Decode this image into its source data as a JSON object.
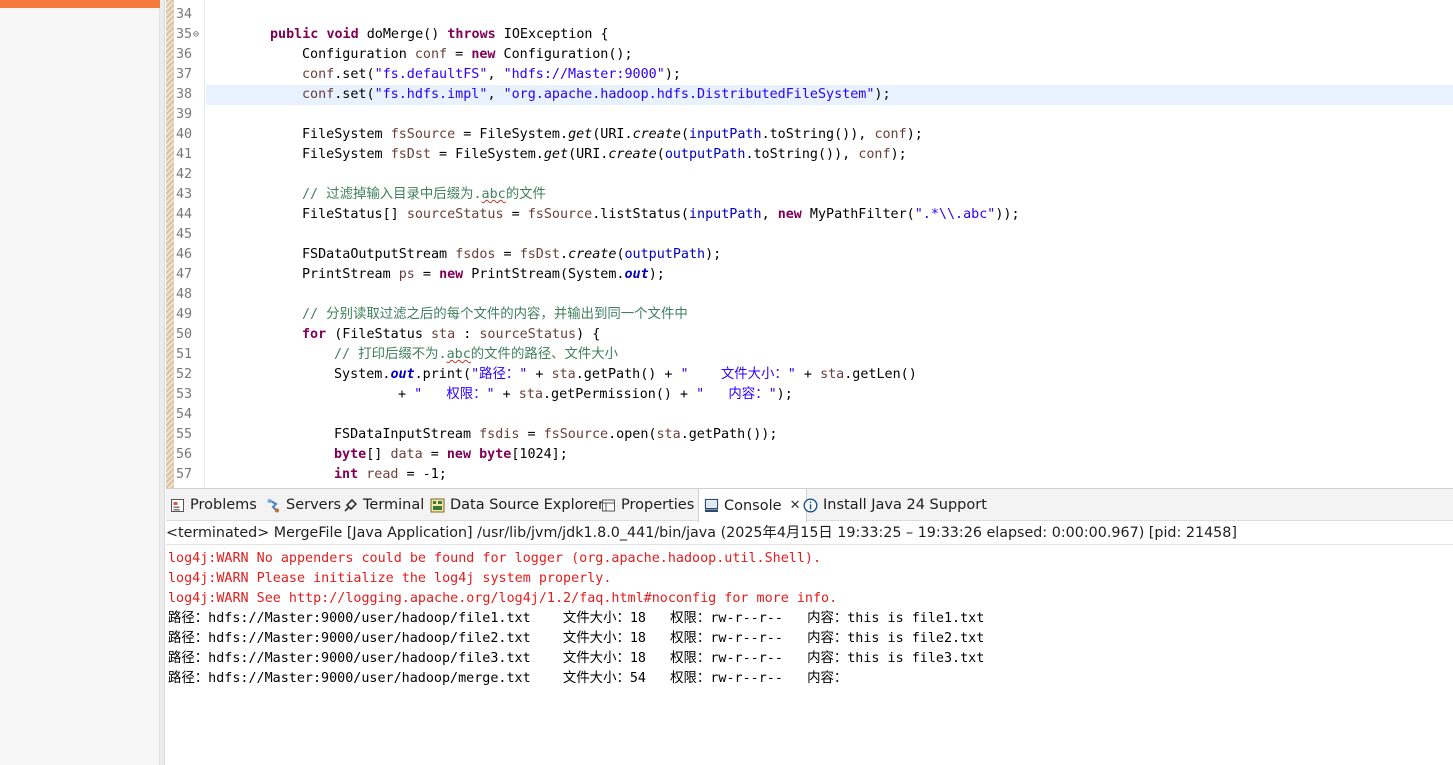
{
  "editor": {
    "lines": [
      {
        "n": "34",
        "text": ""
      },
      {
        "n": "35",
        "fold": true,
        "text": "public void doMerge() throws IOException {"
      },
      {
        "n": "36",
        "text": "Configuration conf = new Configuration();"
      },
      {
        "n": "37",
        "text": "conf.set(\"fs.defaultFS\", \"hdfs://Master:9000\");"
      },
      {
        "n": "38",
        "current": true,
        "text": "conf.set(\"fs.hdfs.impl\", \"org.apache.hadoop.hdfs.DistributedFileSystem\");"
      },
      {
        "n": "39",
        "text": ""
      },
      {
        "n": "40",
        "text": "FileSystem fsSource = FileSystem.get(URI.create(inputPath.toString()), conf);"
      },
      {
        "n": "41",
        "text": "FileSystem fsDst = FileSystem.get(URI.create(outputPath.toString()), conf);"
      },
      {
        "n": "42",
        "text": ""
      },
      {
        "n": "43",
        "text": "// 过滤掉输入目录中后缀为.abc的文件"
      },
      {
        "n": "44",
        "text": "FileStatus[] sourceStatus = fsSource.listStatus(inputPath, new MyPathFilter(\".*\\\\.abc\"));"
      },
      {
        "n": "45",
        "text": ""
      },
      {
        "n": "46",
        "text": "FSDataOutputStream fsdos = fsDst.create(outputPath);"
      },
      {
        "n": "47",
        "text": "PrintStream ps = new PrintStream(System.out);"
      },
      {
        "n": "48",
        "text": ""
      },
      {
        "n": "49",
        "text": "// 分别读取过滤之后的每个文件的内容，并输出到同一个文件中"
      },
      {
        "n": "50",
        "text": "for (FileStatus sta : sourceStatus) {"
      },
      {
        "n": "51",
        "text": "// 打印后缀不为.abc的文件的路径、文件大小"
      },
      {
        "n": "52",
        "text": "System.out.print(\"路径：\" + sta.getPath() + \"    文件大小：\" + sta.getLen()"
      },
      {
        "n": "53",
        "text": "+ \"   权限：\" + sta.getPermission() + \"   内容：\");"
      },
      {
        "n": "54",
        "text": ""
      },
      {
        "n": "55",
        "text": "FSDataInputStream fsdis = fsSource.open(sta.getPath());"
      },
      {
        "n": "56",
        "text": "byte[] data = new byte[1024];"
      },
      {
        "n": "57",
        "text": "int read = -1;"
      }
    ]
  },
  "views": {
    "tabs": [
      {
        "label": "Problems",
        "icon": "problems-icon"
      },
      {
        "label": "Servers",
        "icon": "servers-icon"
      },
      {
        "label": "Terminal",
        "icon": "terminal-icon"
      },
      {
        "label": "Data Source Explorer",
        "icon": "database-icon"
      },
      {
        "label": "Properties",
        "icon": "properties-icon"
      },
      {
        "label": "Console",
        "icon": "console-icon",
        "active": true,
        "close": "✕"
      },
      {
        "label": "Install Java 24 Support",
        "icon": "info-icon"
      }
    ]
  },
  "console": {
    "status": "<terminated> MergeFile [Java Application] /usr/lib/jvm/jdk1.8.0_441/bin/java  (2025年4月15日 19:33:25 – 19:33:26 elapsed: 0:00:00.967) [pid: 21458]",
    "lines": [
      {
        "text": "log4j:WARN No appenders could be found for logger (org.apache.hadoop.util.Shell).",
        "err": true
      },
      {
        "text": "log4j:WARN Please initialize the log4j system properly.",
        "err": true
      },
      {
        "text": "log4j:WARN See http://logging.apache.org/log4j/1.2/faq.html#noconfig for more info.",
        "err": true
      },
      {
        "text": "路径：hdfs://Master:9000/user/hadoop/file1.txt    文件大小：18   权限：rw-r--r--   内容：this is file1.txt"
      },
      {
        "text": "路径：hdfs://Master:9000/user/hadoop/file2.txt    文件大小：18   权限：rw-r--r--   内容：this is file2.txt"
      },
      {
        "text": "路径：hdfs://Master:9000/user/hadoop/file3.txt    文件大小：18   权限：rw-r--r--   内容：this is file3.txt"
      },
      {
        "text": "路径：hdfs://Master:9000/user/hadoop/merge.txt    文件大小：54   权限：rw-r--r--   内容："
      }
    ]
  },
  "colors": {
    "keyword": "#7f0055",
    "string": "#2a00ff",
    "comment": "#3f7f5f",
    "field": "#0000c0",
    "local": "#6a3e3e",
    "error": "#e11e1e",
    "current_line": "#e8f2fe",
    "accent": "#f47b3c"
  }
}
